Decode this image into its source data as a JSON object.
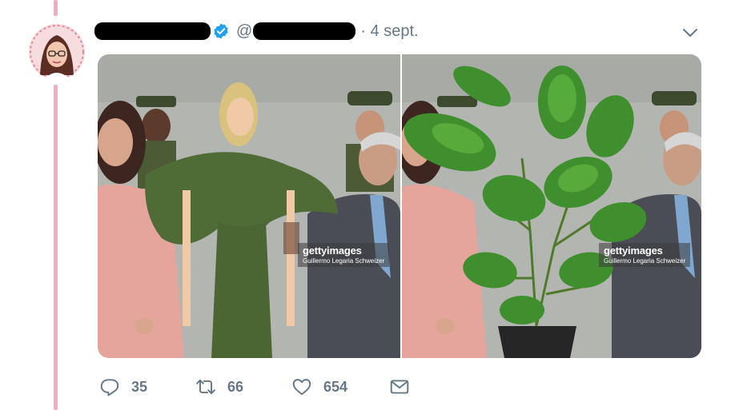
{
  "tweet": {
    "date": "· 4 sept.",
    "handle_prefix": "@",
    "stats": {
      "replies": "35",
      "retweets": "66",
      "likes": "654"
    }
  },
  "media": {
    "left_watermark": {
      "brand": "gettyimages",
      "credit": "Guillermo Legaria Schweizer"
    },
    "right_watermark": {
      "brand": "gettyimages",
      "credit": "Guillermo Legaria Schweizer"
    }
  },
  "icons": {
    "verified": "verified-badge-icon",
    "menu": "chevron-down-icon",
    "reply": "reply-icon",
    "retweet": "retweet-icon",
    "like": "heart-icon",
    "dm": "envelope-icon"
  },
  "colors": {
    "thread_line": "#f5a9c3",
    "verified": "#1da1f2",
    "muted": "#657786"
  }
}
